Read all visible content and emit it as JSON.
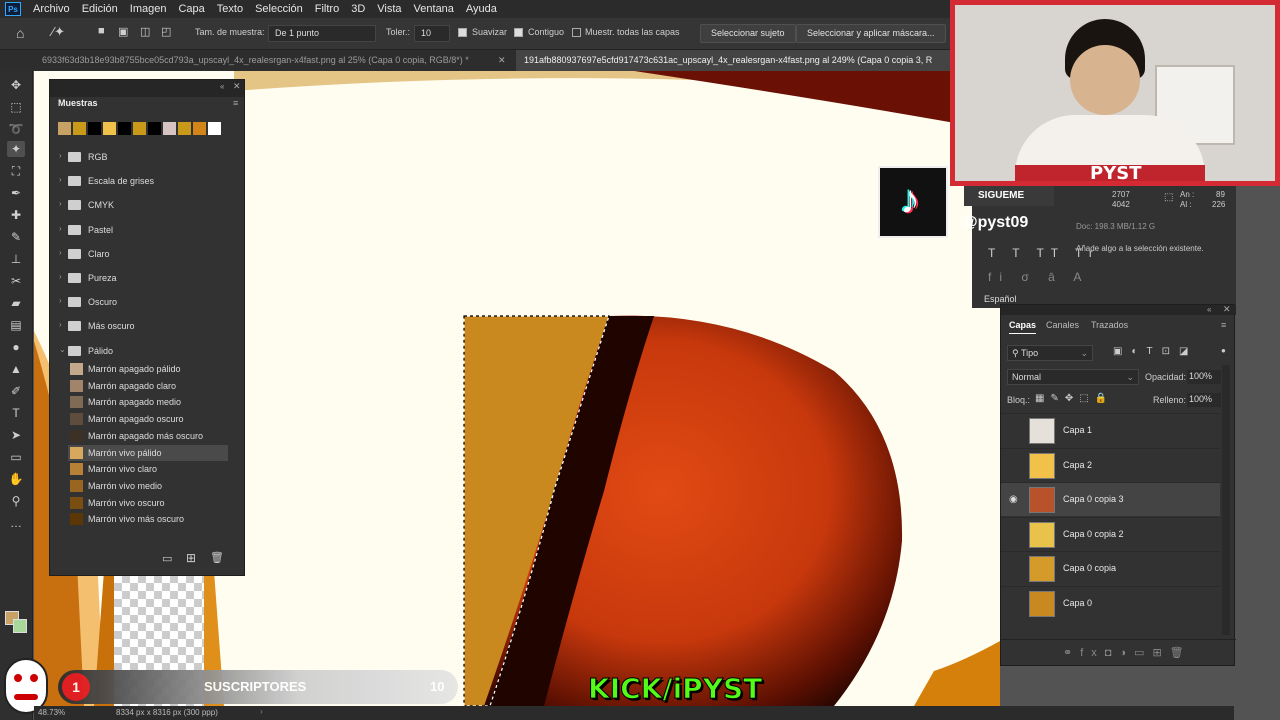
{
  "menu": [
    "Archivo",
    "Edición",
    "Imagen",
    "Capa",
    "Texto",
    "Selección",
    "Filtro",
    "3D",
    "Vista",
    "Ventana",
    "Ayuda"
  ],
  "options": {
    "sample_size_label": "Tam. de muestra:",
    "sample_size_value": "De 1 punto",
    "tolerance_label": "Toler.:",
    "tolerance_value": "10",
    "smooth_label": "Suavizar",
    "contiguous_label": "Contiguo",
    "sample_all_label": "Muestr. todas las capas",
    "select_subject": "Seleccionar sujeto",
    "select_mask": "Seleccionar y aplicar máscara..."
  },
  "tabs": [
    "6933f63d3b18e93b8755bce05cd793a_upscayl_4x_realesrgan-x4fast.png al 25% (Capa 0 copia, RGB/8*) *",
    "191afb880937697e5cfd917473c631ac_upscayl_4x_realesrgan-x4fast.png al 249% (Capa 0 copia 3, R"
  ],
  "swatches": {
    "title": "Muestras",
    "recent": [
      "#c8a265",
      "#c9991a",
      "#000000",
      "#f0c24a",
      "#000000",
      "#c9991a",
      "#000000",
      "#d8c3c3",
      "#c9991a",
      "#d4851a",
      "#ffffff"
    ],
    "folders": [
      "RGB",
      "Escala de grises",
      "CMYK",
      "Pastel",
      "Claro",
      "Pureza",
      "Oscuro",
      "Más oscuro",
      "Pálido"
    ],
    "colors": [
      {
        "label": "Marrón apagado pálido",
        "color": "#c4a88c"
      },
      {
        "label": "Marrón apagado claro",
        "color": "#a18469"
      },
      {
        "label": "Marrón apagado medio",
        "color": "#7f6a56"
      },
      {
        "label": "Marrón apagado oscuro",
        "color": "#5e4d3c"
      },
      {
        "label": "Marrón apagado más oscuro",
        "color": "#3d3126"
      },
      {
        "label": "Marrón vivo pálido",
        "color": "#d9a85f"
      },
      {
        "label": "Marrón vivo claro",
        "color": "#b88037"
      },
      {
        "label": "Marrón vivo medio",
        "color": "#9a6520"
      },
      {
        "label": "Marrón vivo oscuro",
        "color": "#7a4d10"
      },
      {
        "label": "Marrón vivo más oscuro",
        "color": "#5c3706"
      }
    ]
  },
  "overlay": {
    "sigueme": "SIGUEME",
    "handle": "@pyst09",
    "kick": "KICK/iPYST",
    "subs_label": "SUSCRIPTORES",
    "subs_count": "10",
    "sub_badge": "1",
    "shirt_text": "PYST"
  },
  "info": {
    "x": "2707",
    "y": "4042",
    "an_label": "An :",
    "an_value": "89",
    "al_label": "Al :",
    "al_value": "226",
    "doc": "Doc: 198.3 MB/1.12 G",
    "hint": "Añade algo a la selección existente.",
    "lang": "Español"
  },
  "layers": {
    "tabs": [
      "Capas",
      "Canales",
      "Trazados"
    ],
    "filter": "Tipo",
    "blend": "Normal",
    "opacity_label": "Opacidad:",
    "opacity": "100%",
    "lock_label": "Bloq.:",
    "fill_label": "Relleno:",
    "fill": "100%",
    "items": [
      {
        "name": "Capa 1",
        "visible": false,
        "active": false,
        "thumb": "#e6e0da"
      },
      {
        "name": "Capa 2",
        "visible": false,
        "active": false,
        "thumb": "#f2c14a"
      },
      {
        "name": "Capa 0 copia 3",
        "visible": true,
        "active": true,
        "thumb": "#b8522a"
      },
      {
        "name": "Capa 0 copia 2",
        "visible": false,
        "active": false,
        "thumb": "#e8c24a"
      },
      {
        "name": "Capa 0 copia",
        "visible": false,
        "active": false,
        "thumb": "#d49a2a"
      },
      {
        "name": "Capa 0",
        "visible": false,
        "active": false,
        "thumb": "#c88a20"
      }
    ]
  },
  "status": {
    "zoom": "48.73%",
    "size": "8334 px x 8316 px (300 ppp)"
  }
}
